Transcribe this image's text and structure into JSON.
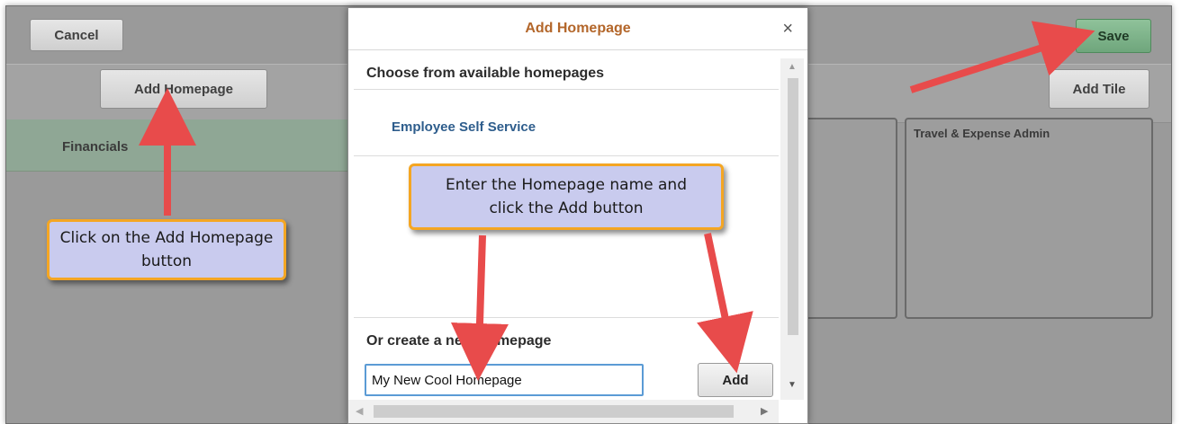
{
  "toolbar": {
    "cancel_label": "Cancel",
    "save_label": "Save"
  },
  "left_panel": {
    "add_homepage_label": "Add Homepage",
    "selected_item": "Financials"
  },
  "right_panel": {
    "add_tile_label": "Add Tile",
    "tile_title": "Travel & Expense Admin"
  },
  "modal": {
    "title": "Add Homepage",
    "close_glyph": "×",
    "choose_heading": "Choose from available homepages",
    "homepages": [
      "Employee Self Service"
    ],
    "create_heading": "Or create a new Homepage",
    "input_value": "My New Cool Homepage",
    "add_label": "Add"
  },
  "callouts": {
    "left": "Click on the Add Homepage button",
    "center": "Enter the Homepage name and click the Add button"
  },
  "colors": {
    "accent_orange": "#f4a623",
    "arrow_red": "#e84b4b",
    "save_green": "#7fb08a",
    "selected_row": "#8fa795"
  }
}
